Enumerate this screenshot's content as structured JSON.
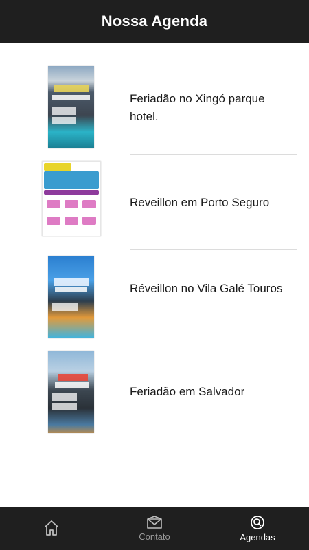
{
  "header": {
    "title": "Nossa Agenda"
  },
  "items": [
    {
      "label": "Feriadão no Xingó parque hotel."
    },
    {
      "label": "Reveillon em Porto Seguro"
    },
    {
      "label": "Réveillon no Vila Galé Touros"
    },
    {
      "label": "Feriadão em Salvador"
    }
  ],
  "tabs": [
    {
      "label": "",
      "icon": "home-icon"
    },
    {
      "label": "Contato",
      "icon": "envelope-icon"
    },
    {
      "label": "Agendas",
      "icon": "search-icon"
    }
  ],
  "colors": {
    "bar": "#1f1f1f",
    "separator": "#dcdcdc",
    "inactive_tab": "#9a9a9a"
  }
}
